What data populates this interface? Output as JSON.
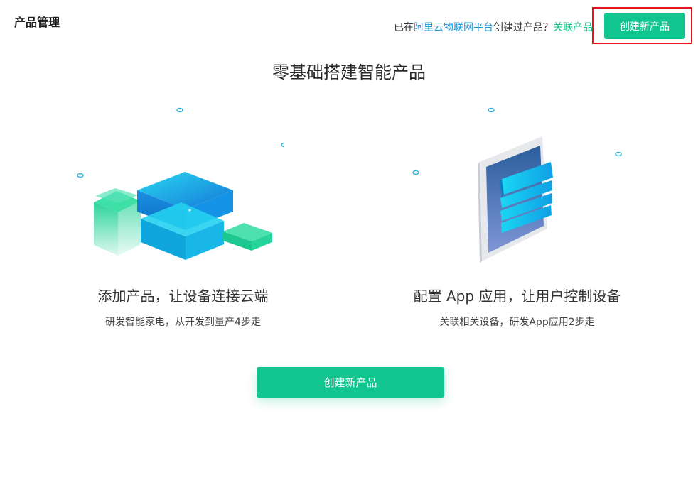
{
  "header": {
    "page_title": "产品管理",
    "prompt_prefix": "已在",
    "prompt_platform_link": "阿里云物联网平台",
    "prompt_suffix": "创建过产品？",
    "link_existing_label": "关联产品",
    "create_button_label": "创建新产品"
  },
  "hero": {
    "title": "零基础搭建智能产品"
  },
  "cards": [
    {
      "title": "添加产品，让设备连接云端",
      "description": "研发智能家电，从开发到量产4步走",
      "illustration": "cloud-cubes-illustration"
    },
    {
      "title": "配置 App 应用，让用户控制设备",
      "description": "关联相关设备，研发App应用2步走",
      "illustration": "tablet-app-illustration"
    }
  ],
  "main": {
    "create_button_label": "创建新产品"
  },
  "colors": {
    "primary_green": "#12c58e",
    "link_blue": "#1a9bd7",
    "highlight_red": "#e8141b"
  }
}
